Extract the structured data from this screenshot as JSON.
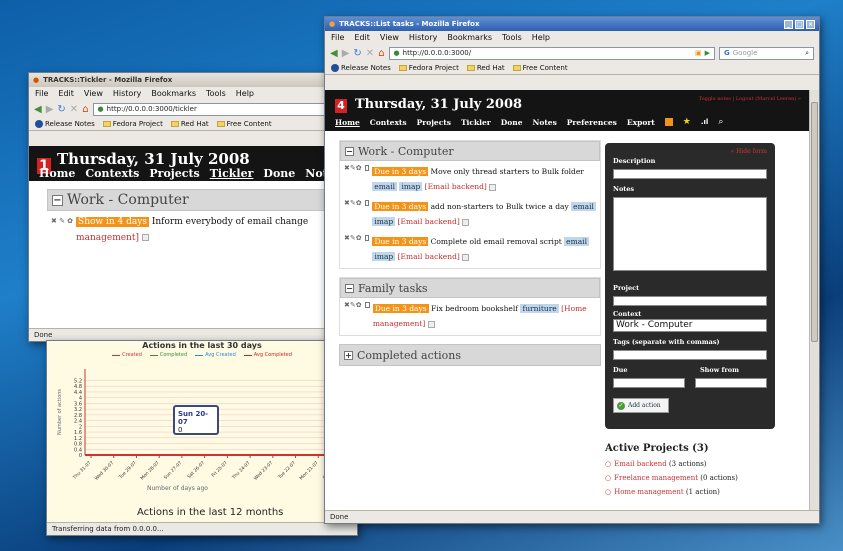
{
  "win_back": {
    "title": "TRACKS::Tickler - Mozilla Firefox",
    "menu": [
      "File",
      "Edit",
      "View",
      "History",
      "Bookmarks",
      "Tools",
      "Help"
    ],
    "url": "http://0.0.0.0:3000/tickler",
    "bookmarks": [
      "Release Notes",
      "Fedora Project",
      "Red Hat",
      "Free Content"
    ],
    "date_num": "1",
    "date": "Thursday, 31 July 2008",
    "nav": [
      "Home",
      "Contexts",
      "Projects",
      "Tickler",
      "Done",
      "Notes"
    ],
    "context": "Work - Computer",
    "show_in": "Show in 4 days",
    "task": "Inform everybody of email change",
    "project_tail": "management]",
    "status": "Done"
  },
  "win_chart": {
    "title": "Actions in the last 30 days",
    "legend": [
      "Created",
      "Completed",
      "Avg Created",
      "Avg Completed"
    ],
    "y_label": "Number of actions",
    "x_label": "Number of days ago",
    "tooltip_date": "Sun 20-07",
    "tooltip_val": "0",
    "footer_title": "Actions in the last 12 months",
    "status": "Transferring data from 0.0.0.0...",
    "chart_data": {
      "type": "bar",
      "yticks": [
        "0",
        "0.4",
        "0.8",
        "1.2",
        "1.6",
        "2",
        "2.4",
        "2.8",
        "3.2",
        "3.6",
        "4",
        "4.4",
        "4.8",
        "5.2"
      ],
      "xticks": [
        "Thu 31-07",
        "Wed 30-07",
        "Tue 29-07",
        "Mon 28-07",
        "Sun 27-07",
        "Sat 26-07",
        "Fri 25-07",
        "Thu 24-07",
        "Wed 23-07",
        "Tue 22-07",
        "Mon 21-07",
        "Sun 20-07"
      ],
      "ylim": [
        0,
        6
      ]
    }
  },
  "win_front": {
    "title": "TRACKS::List tasks - Mozilla Firefox",
    "menu": [
      "File",
      "Edit",
      "View",
      "History",
      "Bookmarks",
      "Tools",
      "Help"
    ],
    "url": "http://0.0.0.0:3000/",
    "search_placeholder": "Google",
    "bookmarks": [
      "Release Notes",
      "Fedora Project",
      "Red Hat",
      "Free Content"
    ],
    "date_num": "4",
    "date": "Thursday, 31 July 2008",
    "toplinks": "Toggle notes | Logout (Marcel Leeren) »",
    "nav": [
      "Home",
      "Contexts",
      "Projects",
      "Tickler",
      "Done",
      "Notes",
      "Preferences",
      "Export"
    ],
    "contexts": [
      {
        "name": "Work - Computer",
        "tasks": [
          {
            "due": "Due in 3 days",
            "text": "Move only thread starters to Bulk folder",
            "tags": [
              "email",
              "imap"
            ],
            "project": "[Email backend]"
          },
          {
            "due": "Due in 3 days",
            "text": "add non-starters to Bulk twice a day",
            "tags": [
              "email",
              "imap"
            ],
            "project": "[Email backend]"
          },
          {
            "due": "Due in 3 days",
            "text": "Complete old email removal script",
            "tags": [
              "email",
              "imap"
            ],
            "project": "[Email backend]"
          }
        ]
      },
      {
        "name": "Family tasks",
        "tasks": [
          {
            "due": "Due in 3 days",
            "text": "Fix bedroom bookshelf",
            "tags": [
              "furniture"
            ],
            "project": "[Home management]"
          }
        ]
      }
    ],
    "completed": "Completed actions",
    "form": {
      "hide_link": "« Hide form",
      "description": "Description",
      "notes": "Notes",
      "project": "Project",
      "context": "Context",
      "context_value": "Work - Computer",
      "tags": "Tags (separate with commas)",
      "due": "Due",
      "show_from": "Show from",
      "add": "Add action"
    },
    "active_projects": {
      "title": "Active Projects (3)",
      "items": [
        {
          "name": "Email backend",
          "count": "(3 actions)"
        },
        {
          "name": "Freelance management",
          "count": "(0 actions)"
        },
        {
          "name": "Home management",
          "count": "(1 action)"
        }
      ]
    },
    "status": "Done"
  }
}
